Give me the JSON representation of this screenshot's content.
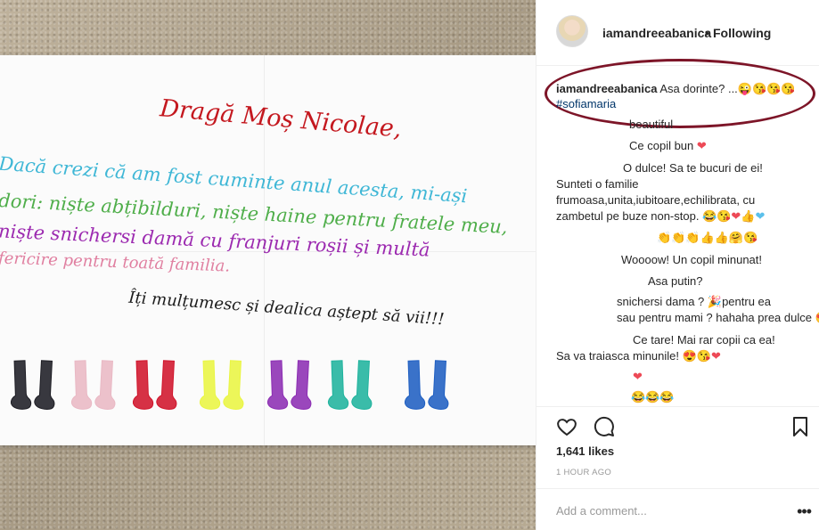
{
  "photo": {
    "letter": {
      "title": "Dragă Moș Nicolae,",
      "line1": "Dacă crezi că am fost cuminte anul acesta, mi-ași",
      "line2": "dori: niște abțibilduri, niște haine pentru fratele meu,",
      "line3": "niște snichersi damă cu franjuri roșii și multă",
      "line4": "fericire pentru toată familia.",
      "line5": "Îți mulțumesc și dealica aștept să vii!!!"
    },
    "sock_colors": [
      "#1d1d24",
      "#e9b8c4",
      "#d0142b",
      "#e9f542",
      "#8c2db3",
      "#1fb39d",
      "#1f5fc2"
    ]
  },
  "header": {
    "username": "iamandreeabanica",
    "separator": "•",
    "follow_status": "Following"
  },
  "caption": {
    "username": "iamandreeabanica",
    "text": "Asa dorinte? ...😜😘😘😘",
    "hashtag": "#sofiamaria"
  },
  "comments": [
    "beautiful",
    "Ce copil bun",
    "O dulce! Sa te bucuri de ei!",
    "Sunteti o familie",
    "frumoasa,unita,iubitoare,echilibrata, cu",
    "zambetul pe buze non-stop. 😂😘",
    "👏👏👏👍👍🤗😘",
    "Woooow! Un copil minunat!",
    "Asa putin?",
    "snichersi dama ? 🎉pentru ea",
    "sau pentru mami ? hahaha prea dulce 😍",
    "Ce tare! Mai rar copii ca ea!",
    "Sa va traiasca minunile! 😍😘",
    "😂😂😂"
  ],
  "actions": {
    "like_icon": "heart-outline-icon",
    "comment_icon": "speech-bubble-icon",
    "save_icon": "bookmark-icon"
  },
  "likes": "1,641 likes",
  "timestamp": "1 HOUR AGO",
  "comment_box": {
    "placeholder": "Add a comment...",
    "more_label": "•••"
  },
  "colors": {
    "oval": "#7d1528",
    "heart": "#ed4956",
    "hashtag": "#003569"
  }
}
